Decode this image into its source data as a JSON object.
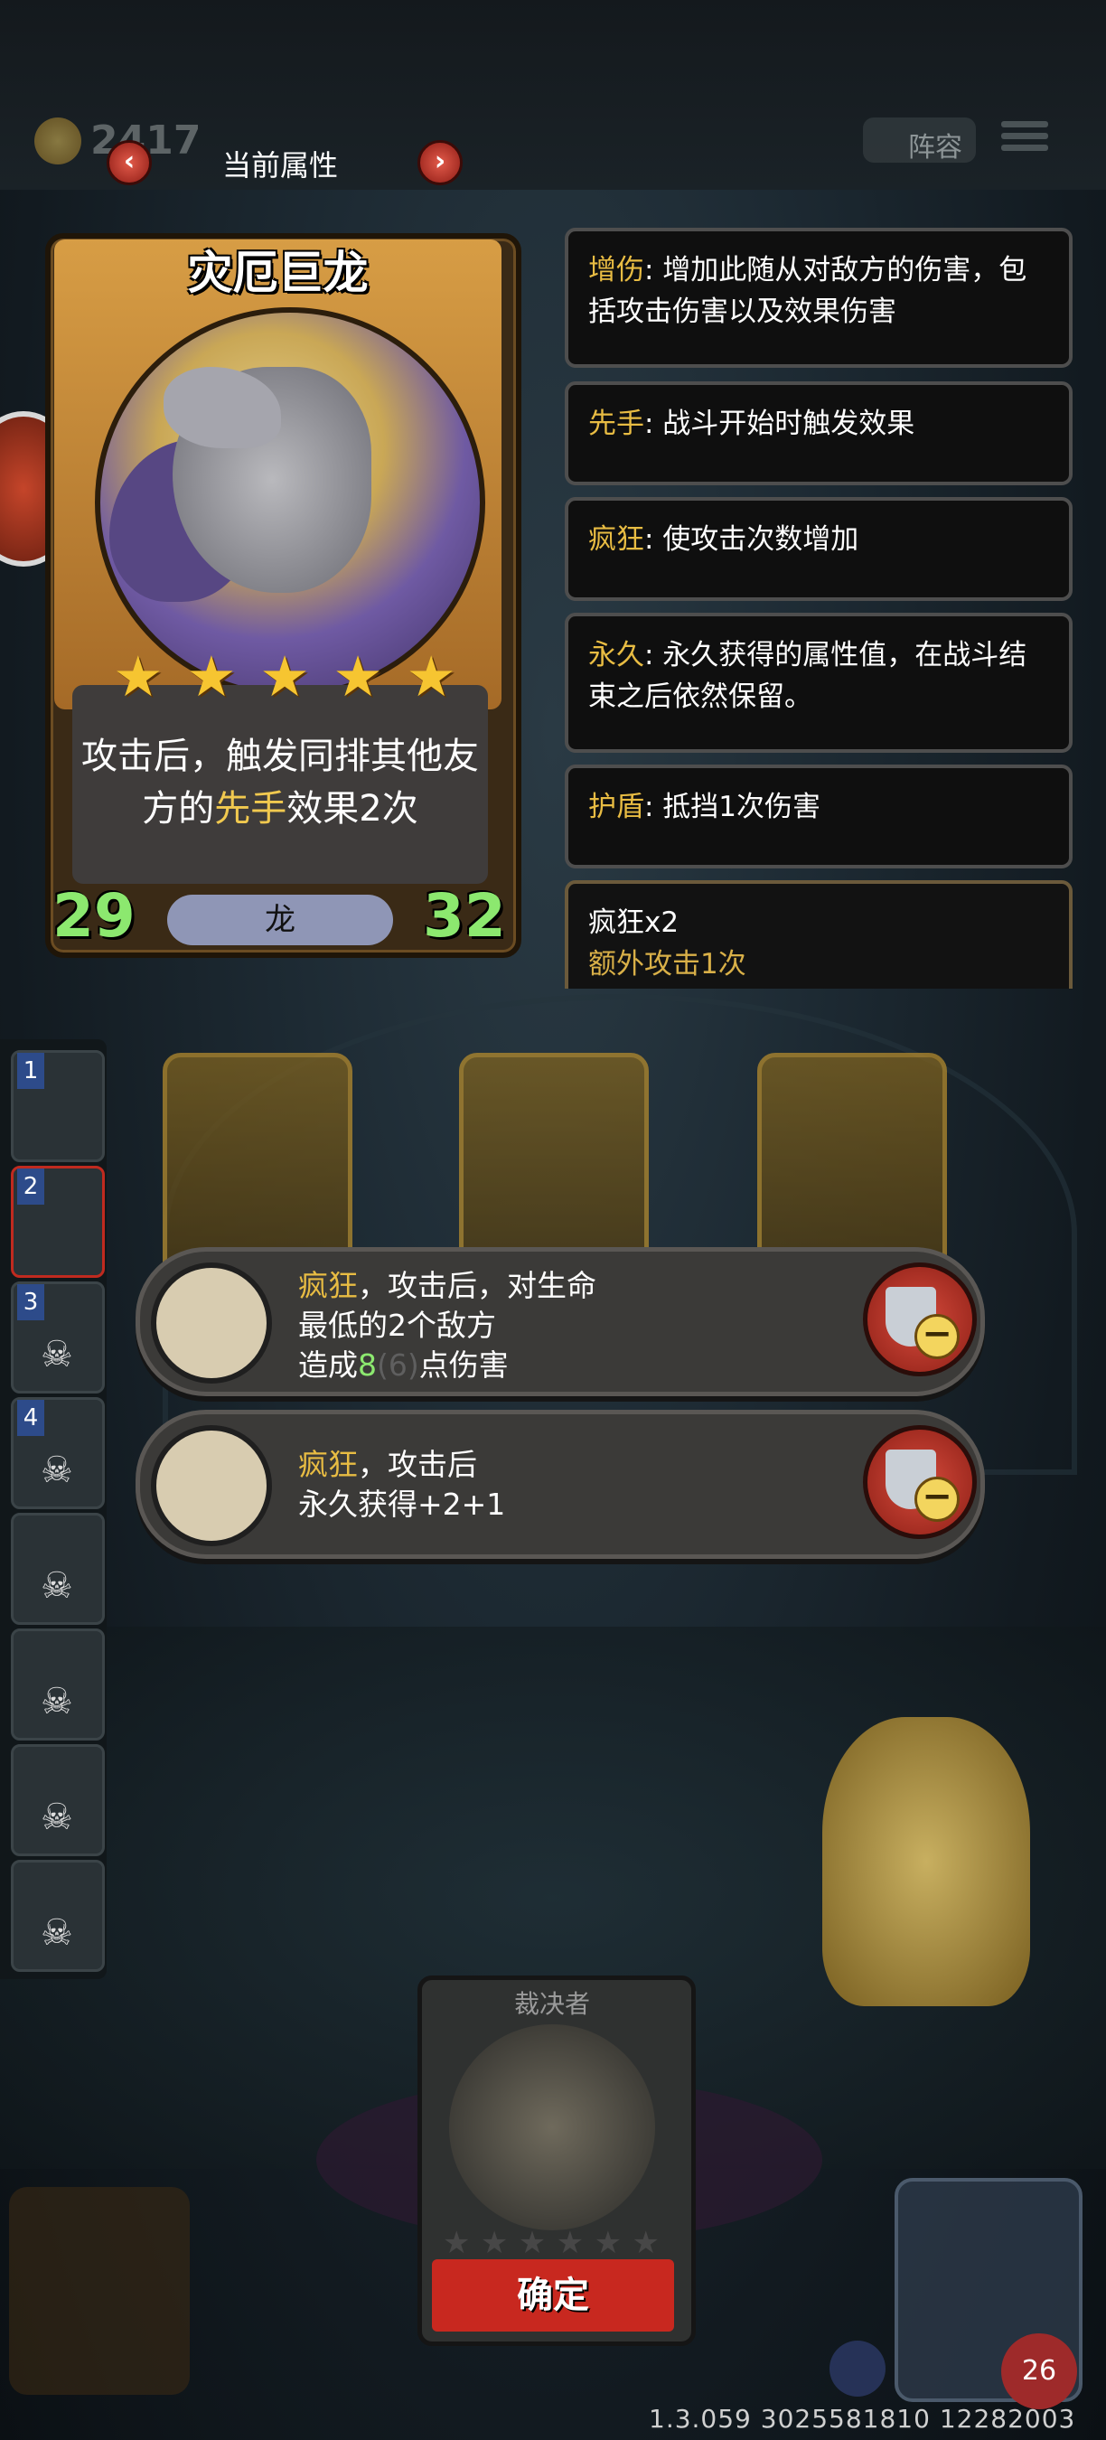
{
  "top_bar": {
    "coins": "2417",
    "panel_title": "当前属性",
    "prev_arrow": "‹",
    "next_arrow": "›",
    "lineup_label": "阵容"
  },
  "card": {
    "name": "灾厄巨龙",
    "stars": [
      "★",
      "★",
      "★",
      "★",
      "★"
    ],
    "ability_pre": "攻击后，触发同排其他友方的",
    "ability_keyword": "先手",
    "ability_post": "效果2次",
    "attack": "29",
    "health": "32",
    "tribe": "龙"
  },
  "keywords": [
    {
      "name": "增伤",
      "desc": ": 增加此随从对敌方的伤害，包括攻击伤害以及效果伤害"
    },
    {
      "name": "先手",
      "desc": ": 战斗开始时触发效果"
    },
    {
      "name": "疯狂",
      "desc": ": 使攻击次数增加"
    },
    {
      "name": "永久",
      "desc": ": 永久获得的属性值，在战斗结束之后依然保留。"
    },
    {
      "name": "护盾",
      "desc": ": 抵挡1次伤害"
    }
  ],
  "madness_detail": {
    "title": "疯狂x2",
    "subtitle": "额外攻击1次"
  },
  "roster_numbers": [
    "1",
    "2",
    "3",
    "4"
  ],
  "buffs": [
    {
      "keyword": "疯狂",
      "line1_rest": "，攻击后，对生命",
      "line2": "最低的2个敌方",
      "line3_pre": "造成",
      "line3_value": "8",
      "line3_faint": "(6)",
      "line3_post": "点伤害"
    },
    {
      "keyword": "疯狂",
      "line1_rest": "，攻击后",
      "line2": "永久获得+2+1"
    }
  ],
  "bottom": {
    "judge_name": "裁决者",
    "judge_stars": [
      "★",
      "★",
      "★",
      "★",
      "★",
      "★"
    ],
    "confirm_label": "确定",
    "health_badge": "26",
    "version": "1.3.059 3025581810 12282003"
  },
  "colors": {
    "keyword": "#e8bc43",
    "stat_green": "#8ce86f",
    "confirm_red": "#c8281f"
  }
}
